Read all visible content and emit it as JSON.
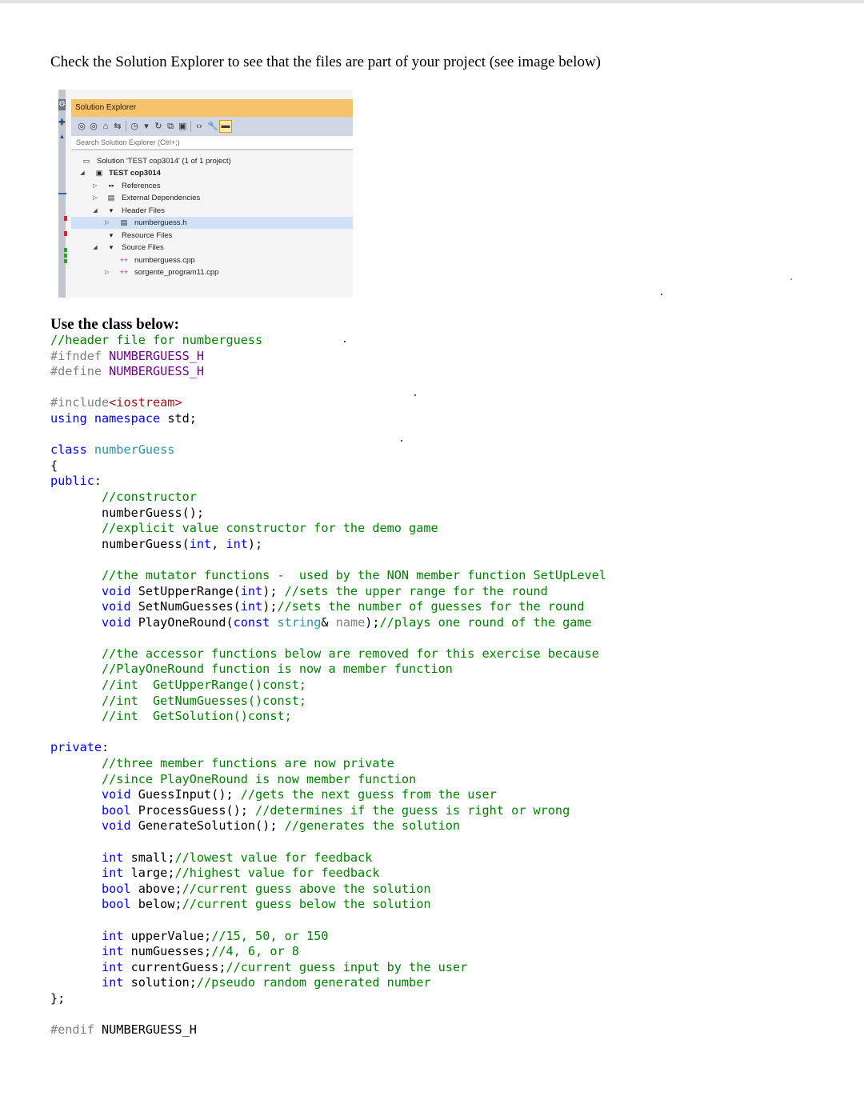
{
  "intro_text": "Check the Solution Explorer to see that the files are part of your project (see image below)",
  "solution_explorer": {
    "title": "Solution Explorer",
    "search_placeholder": "Search Solution Explorer (Ctrl+;)",
    "toolbar_icons": [
      "back-icon",
      "forward-icon",
      "home-icon",
      "sync-icon",
      "history-icon",
      "refresh-icon",
      "collapse-icon",
      "show-all-files-icon",
      "code-view-icon",
      "properties-icon",
      "pin-icon"
    ],
    "tree": [
      {
        "label": "Solution 'TEST cop3014' (1 of 1 project)",
        "icon": "solution-icon"
      },
      {
        "label": "TEST cop3014",
        "icon": "project-icon"
      },
      {
        "label": "References",
        "icon": "references-icon"
      },
      {
        "label": "External Dependencies",
        "icon": "dependencies-icon"
      },
      {
        "label": "Header Files",
        "icon": "folder-icon"
      },
      {
        "label": "numberguess.h",
        "icon": "header-file-icon"
      },
      {
        "label": "Resource Files",
        "icon": "folder-icon"
      },
      {
        "label": "Source Files",
        "icon": "folder-icon"
      },
      {
        "label": "numberguess.cpp",
        "icon": "cpp-file-icon"
      },
      {
        "label": "sorgente_program11.cpp",
        "icon": "cpp-file-icon"
      }
    ]
  },
  "heading": "Use the class  below:",
  "code_lines": [
    "//header file for numberguess",
    "#ifndef NUMBERGUESS_H",
    "#define NUMBERGUESS_H",
    "",
    "#include<iostream>",
    "using namespace std;",
    "",
    "class numberGuess",
    "{",
    "public:",
    "       //constructor",
    "       numberGuess();",
    "       //explicit value constructor for the demo game",
    "       numberGuess(int, int);",
    "",
    "       //the mutator functions -  used by the NON member function SetUpLevel",
    "       void SetUpperRange(int); //sets the upper range for the round",
    "       void SetNumGuesses(int);//sets the number of guesses for the round",
    "       void PlayOneRound(const string& name);//plays one round of the game",
    "",
    "       //the accessor functions below are removed for this exercise because",
    "       //PlayOneRound function is now a member function",
    "       //int  GetUpperRange()const;",
    "       //int  GetNumGuesses()const;",
    "       //int  GetSolution()const;",
    "",
    "private:",
    "       //three member functions are now private",
    "       //since PlayOneRound is now member function",
    "       void GuessInput(); //gets the next guess from the user",
    "       bool ProcessGuess(); //determines if the guess is right or wrong",
    "       void GenerateSolution(); //generates the solution",
    "",
    "       int small;//lowest value for feedback",
    "       int large;//highest value for feedback",
    "       bool above;//current guess above the solution",
    "       bool below;//current guess below the solution",
    "",
    "       int upperValue;//15, 50, or 150",
    "       int numGuesses;//4, 6, or 8",
    "       int currentGuess;//current guess input by the user",
    "       int solution;//pseudo random generated number",
    "};",
    "",
    "#endif NUMBERGUESS_H"
  ]
}
